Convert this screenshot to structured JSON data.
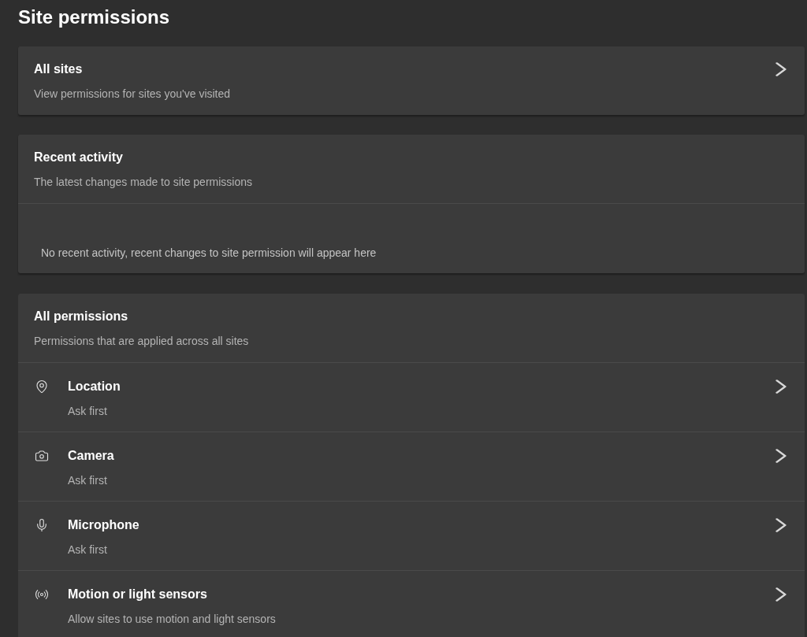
{
  "page": {
    "title": "Site permissions"
  },
  "all_sites": {
    "title": "All sites",
    "subtitle": "View permissions for sites you've visited"
  },
  "recent_activity": {
    "title": "Recent activity",
    "subtitle": "The latest changes made to site permissions",
    "empty_message": "No recent activity, recent changes to site permission will appear here"
  },
  "all_permissions": {
    "title": "All permissions",
    "subtitle": "Permissions that are applied across all sites",
    "items": [
      {
        "kind": "location",
        "label": "Location",
        "status": "Ask first"
      },
      {
        "kind": "camera",
        "label": "Camera",
        "status": "Ask first"
      },
      {
        "kind": "microphone",
        "label": "Microphone",
        "status": "Ask first"
      },
      {
        "kind": "sensors",
        "label": "Motion or light sensors",
        "status": "Allow sites to use motion and light sensors"
      }
    ]
  }
}
